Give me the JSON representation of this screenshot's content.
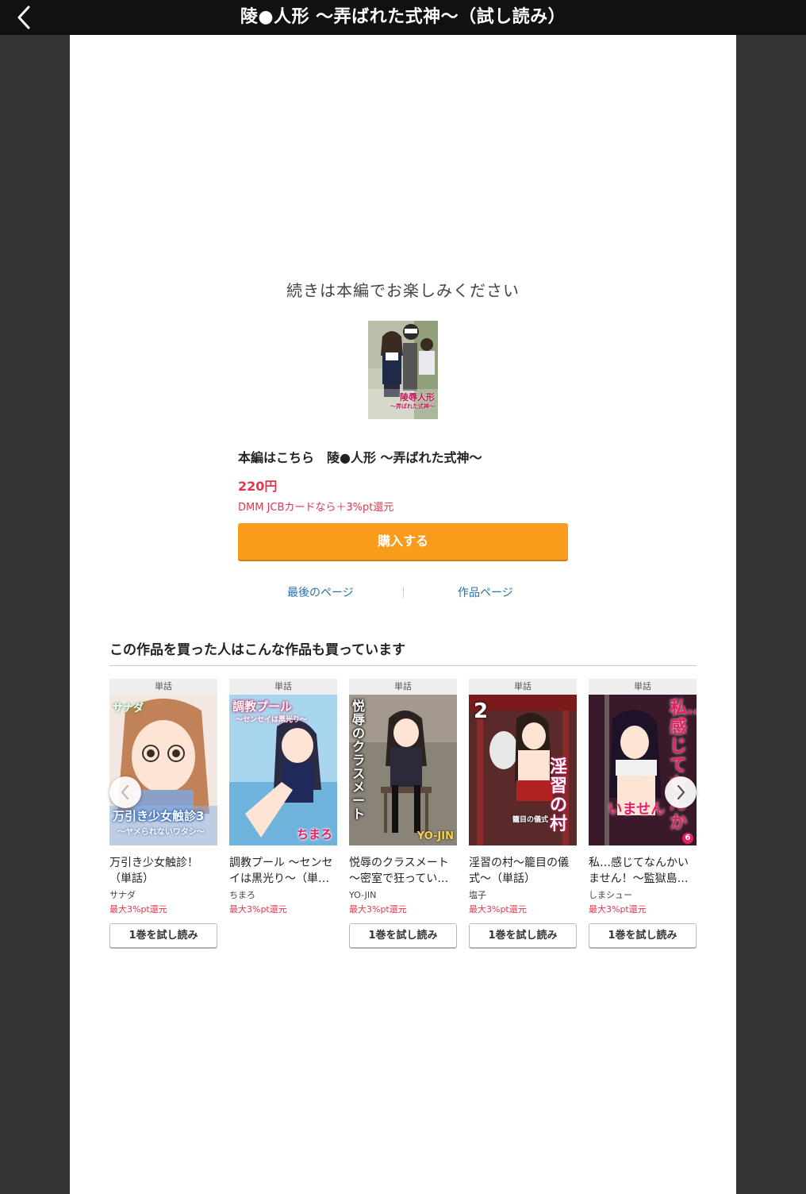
{
  "header": {
    "title": "陵●人形 〜弄ばれた式神〜（試し読み）"
  },
  "main": {
    "continue_message": "続きは本編でお楽しみください",
    "product_name": "本編はこちら　陵●人形 〜弄ばれた式神〜",
    "price": "220円",
    "point_note": "DMM JCBカードなら＋3%pt還元",
    "buy_label": "購入する",
    "last_page_label": "最後のページ",
    "product_page_label": "作品ページ",
    "cover_text": "陵辱人形",
    "cover_subtext": "〜弄ばれた式神〜"
  },
  "recommendations": {
    "heading": "この作品を買った人はこんな作品も買っています",
    "items": [
      {
        "type": "単話",
        "title": "万引き少女触診！（単話）",
        "author": "サナダ",
        "point": "最大3%pt還元",
        "button": "1巻を試し読み",
        "cover_text": "万引き少女触診3",
        "cover_sub": "〜ヤメられないワタシ〜",
        "cover_top": "サナダ"
      },
      {
        "type": "単話",
        "title": "調教プール 〜センセイは黒光り〜（単…",
        "author": "ちまろ",
        "point": "最大3%pt還元",
        "button": "1巻を試し読み",
        "cover_text": "調教プール",
        "cover_sub": "〜センセイは黒光り〜",
        "cover_top": "ちまろ"
      },
      {
        "type": "単話",
        "title": "悦辱のクラスメート 〜密室で狂ってい…",
        "author": "YO-JIN",
        "point": "最大3%pt還元",
        "button": "1巻を試し読み",
        "cover_text": "悦辱のクラスメート",
        "cover_sub": "YO-JIN",
        "cover_top": ""
      },
      {
        "type": "単話",
        "title": "淫習の村〜籠目の儀式〜（単話）",
        "author": "塩子",
        "point": "最大3%pt還元",
        "button": "1巻を試し読み",
        "cover_text": "淫習の村",
        "cover_sub": "籠目の儀式",
        "cover_top": "2"
      },
      {
        "type": "単話",
        "title": "私…感じてなんかいません！〜監獄島…",
        "author": "しまシュー",
        "point": "最大3%pt還元",
        "button": "1巻を試し読み",
        "cover_text": "私…感じてなんか",
        "cover_sub": "いません",
        "cover_top": "6"
      }
    ]
  },
  "colors": {
    "accent": "#f99c1c",
    "price": "#e2364d",
    "link": "#2a6fa8"
  },
  "icons": {
    "back": "chevron-left-icon",
    "prev": "chevron-left-icon",
    "next": "chevron-right-icon"
  }
}
